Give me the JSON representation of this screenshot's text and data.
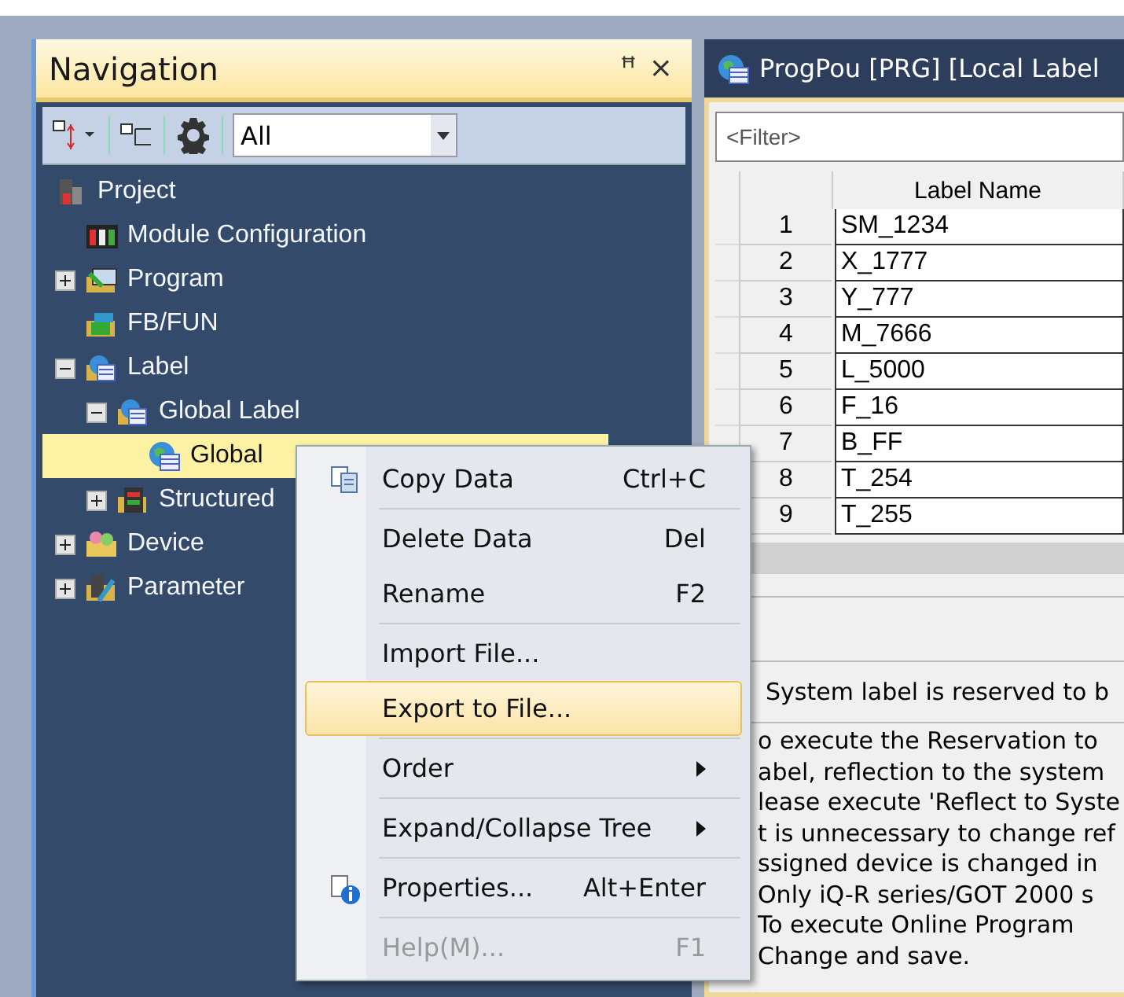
{
  "navigation": {
    "title": "Navigation",
    "pin": "ꟸ",
    "close": "×",
    "filter": {
      "value": "All"
    },
    "tree": [
      {
        "label": "Project",
        "kind": "project",
        "children": [
          {
            "label": "Module Configuration",
            "kind": "module"
          },
          {
            "label": "Program",
            "kind": "program",
            "expanded": false
          },
          {
            "label": "FB/FUN",
            "kind": "fbfun"
          },
          {
            "label": "Label",
            "kind": "label",
            "expanded": true,
            "children": [
              {
                "label": "Global Label",
                "kind": "label",
                "expanded": true,
                "children": [
                  {
                    "label": "Global",
                    "kind": "globe",
                    "selected": true
                  }
                ]
              },
              {
                "label": "Structured",
                "kind": "struct",
                "expanded": false
              }
            ]
          },
          {
            "label": "Device",
            "kind": "device",
            "expanded": false
          },
          {
            "label": "Parameter",
            "kind": "param",
            "expanded": false
          }
        ]
      }
    ]
  },
  "editor": {
    "title": "ProgPou [PRG] [Local Label",
    "filter": {
      "placeholder": "<Filter>"
    },
    "table": {
      "columns": [
        "",
        "Label Name"
      ],
      "rows": [
        [
          "1",
          "SM_1234"
        ],
        [
          "2",
          "X_1777"
        ],
        [
          "3",
          "Y_777"
        ],
        [
          "4",
          "M_7666"
        ],
        [
          "5",
          "L_5000"
        ],
        [
          "6",
          "F_16"
        ],
        [
          "7",
          "B_FF"
        ],
        [
          "8",
          "T_254"
        ],
        [
          "9",
          "T_255"
        ]
      ]
    },
    "message": "System label is reserved to b",
    "explanation": [
      "o execute the Reservation to",
      "abel, reflection to the system",
      "lease execute 'Reflect to Syste",
      "t is unnecessary to change ref",
      "ssigned device is changed in",
      "Only iQ-R series/GOT 2000 s",
      "To execute Online Program",
      "Change and save."
    ]
  },
  "context_menu": [
    {
      "label": "Copy Data",
      "shortcut": "Ctrl+C",
      "kind": "copy",
      "separator_after": true,
      "highlighted": false,
      "disabled": false
    },
    {
      "label": "Delete Data",
      "shortcut": "Del",
      "kind": "plain",
      "separator_after": false,
      "highlighted": false,
      "disabled": false
    },
    {
      "label": "Rename",
      "shortcut": "F2",
      "kind": "plain",
      "separator_after": true,
      "highlighted": false,
      "disabled": false
    },
    {
      "label": "Import File...",
      "kind": "plain",
      "separator_after": false,
      "highlighted": false,
      "disabled": false
    },
    {
      "label": "Export to File...",
      "kind": "plain",
      "separator_after": true,
      "highlighted": true,
      "disabled": false
    },
    {
      "label": "Order",
      "kind": "plain",
      "submenu": true,
      "separator_after": true,
      "highlighted": false,
      "disabled": false
    },
    {
      "label": "Expand/Collapse Tree",
      "kind": "plain",
      "submenu": true,
      "separator_after": true,
      "highlighted": false,
      "disabled": false
    },
    {
      "label": "Properties...",
      "shortcut": "Alt+Enter",
      "kind": "properties",
      "separator_after": true,
      "highlighted": false,
      "disabled": false
    },
    {
      "label": "Help(M)...",
      "shortcut": "F1",
      "kind": "plain",
      "separator_after": false,
      "highlighted": false,
      "disabled": true
    }
  ]
}
